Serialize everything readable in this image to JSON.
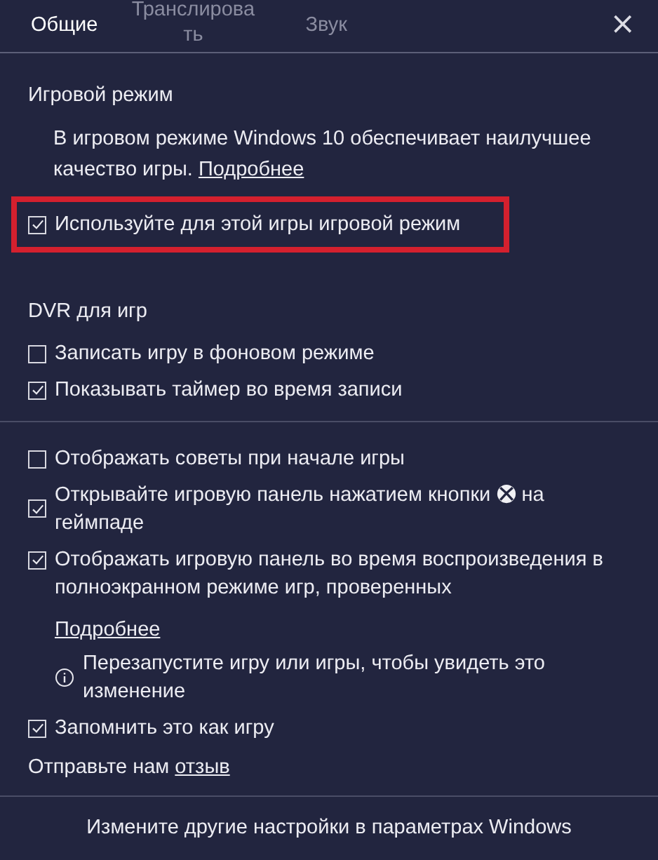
{
  "tabs": [
    {
      "label": "Общие",
      "selected": true
    },
    {
      "label": "Транслировать",
      "selected": false
    },
    {
      "label": "Звук",
      "selected": false
    }
  ],
  "close": "×",
  "sections": [
    {
      "title": "Игровой режим",
      "description": "В игровом режиме Windows 10 обеспечивает наилучшее качество игры.",
      "link": "Подробнее",
      "options": [
        {
          "kind": "checkbox",
          "label": "Используйте для этой игры игровой режим",
          "checked": true,
          "highlighted": true
        }
      ]
    },
    {
      "title": "DVR для игр",
      "options": [
        {
          "kind": "checkbox",
          "label": "Записать игру в фоновом режиме",
          "checked": false,
          "highlighted": false
        },
        {
          "kind": "checkbox",
          "label": "Показывать таймер во время записи",
          "checked": true,
          "highlighted": false
        }
      ]
    },
    {
      "options": [
        {
          "kind": "checkbox",
          "label": "Отображать советы при начале игры",
          "checked": false,
          "highlighted": false
        },
        {
          "kind": "button-checkbox",
          "label": "Открывайте игровую панель нажатием кнопки",
          "label_after": "на геймпаде",
          "checked": true,
          "highlighted": false
        },
        {
          "kind": "checkbox",
          "label": "Отображать игровую панель во время воспроизведения в полноэкранном режиме игр, проверенных",
          "checked": true,
          "highlighted": false
        },
        {
          "kind": "link",
          "label": "Подробнее"
        },
        {
          "kind": "info",
          "label": "Перезапустите игру или игры, чтобы увидеть это изменение"
        },
        {
          "kind": "checkbox",
          "label": "Запомнить это как игру",
          "checked": true,
          "highlighted": false
        }
      ],
      "feedback": {
        "text": "Отправьте нам",
        "link": "отзыв"
      }
    }
  ],
  "footer_button": "Измените другие настройки в параметрах Windows"
}
